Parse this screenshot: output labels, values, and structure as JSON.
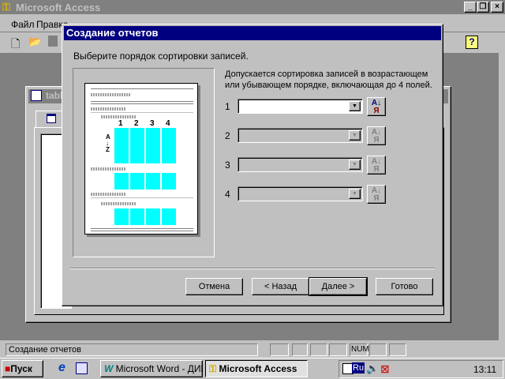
{
  "app": {
    "title": "Microsoft Access",
    "menu": [
      "Файл",
      "Правка"
    ]
  },
  "dialog": {
    "title": "Создание отчетов",
    "prompt": "Выберите порядок сортировки записей.",
    "info": "Допускается сортировка записей в возрастающем или убывающем порядке, включающая до 4 полей.",
    "rows": [
      {
        "num": "1",
        "value": "",
        "enabled": true
      },
      {
        "num": "2",
        "value": "",
        "enabled": false
      },
      {
        "num": "3",
        "value": "",
        "enabled": false
      },
      {
        "num": "4",
        "value": "",
        "enabled": false
      }
    ],
    "sort_icon": "АЯ↓",
    "preview": {
      "col_labels": [
        "1",
        "2",
        "3",
        "4"
      ],
      "az": "А↓Z"
    },
    "buttons": {
      "cancel": "Отмена",
      "back": "< Назад",
      "next": "Далее >",
      "finish": "Готово"
    }
  },
  "bg_window": {
    "title": "tabl"
  },
  "status": {
    "text": "Создание отчетов",
    "num": "NUM"
  },
  "taskbar": {
    "start": "Пуск",
    "tasks": [
      {
        "label": "Microsoft Word - ДИПЛО...",
        "active": false
      },
      {
        "label": "Microsoft Access",
        "active": true
      }
    ],
    "lang": "Ru",
    "clock": "13:11"
  }
}
